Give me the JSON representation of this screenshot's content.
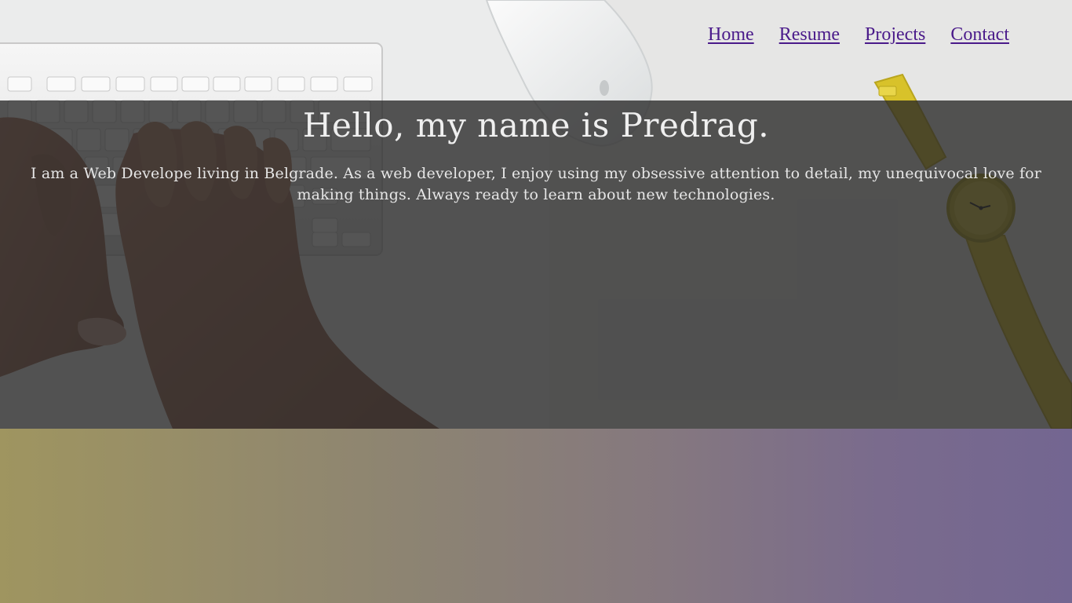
{
  "nav": {
    "items": [
      {
        "label": "Home"
      },
      {
        "label": "Resume"
      },
      {
        "label": "Projects"
      },
      {
        "label": "Contact"
      }
    ]
  },
  "hero": {
    "title": "Hello, my name is Predrag.",
    "subtitle": "I am a Web Develope living in Belgrade. As a web developer, I enjoy using my obsessive attention to detail, my unequivocal love for making things. Always ready to learn about new technologies."
  },
  "colors": {
    "link": "#4a1a8a",
    "overlay": "#262626",
    "gradient_left": "#9f9560",
    "gradient_right": "#736691",
    "watch_strap": "#d8c22a"
  }
}
